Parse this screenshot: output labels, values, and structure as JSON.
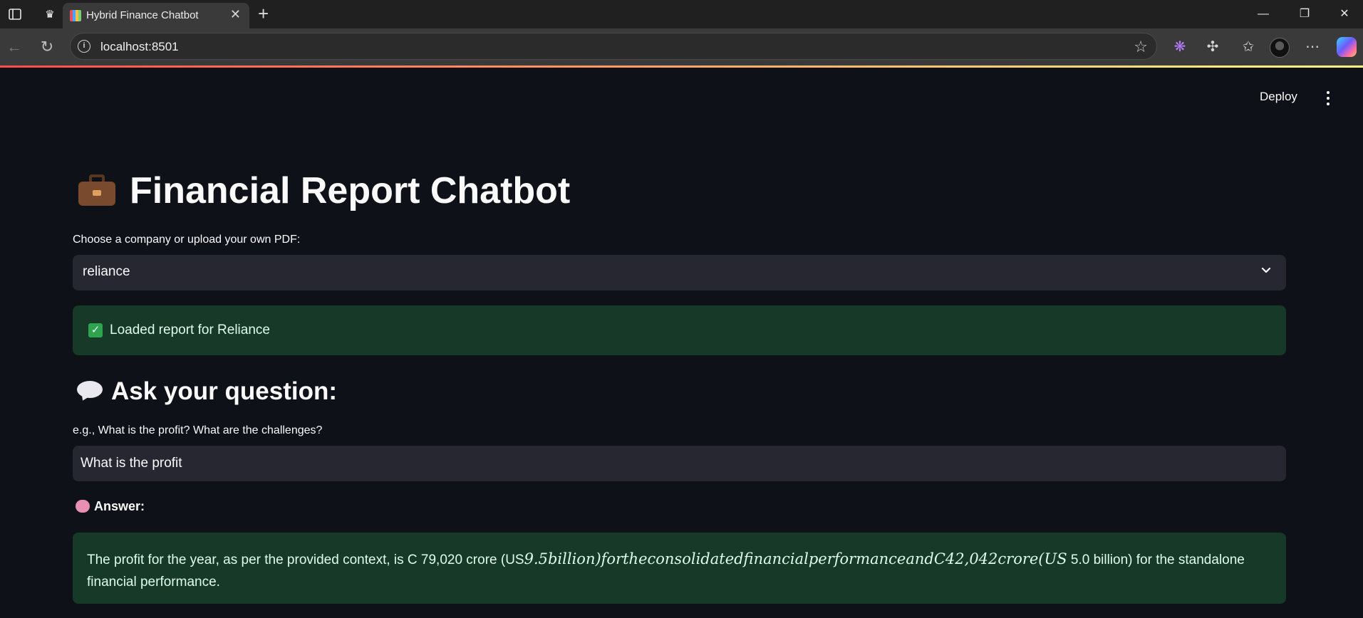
{
  "browser": {
    "tab_title": "Hybrid Finance Chatbot",
    "url": "localhost:8501"
  },
  "header": {
    "deploy_label": "Deploy"
  },
  "page": {
    "title": "Financial Report Chatbot",
    "select_label": "Choose a company or upload your own PDF:",
    "selected_company": "reliance",
    "success_message": "Loaded report for Reliance",
    "ask_heading": "Ask your question:",
    "question_label": "e.g., What is the profit? What are the challenges?",
    "question_value": "What is the profit",
    "answer_label": "Answer:",
    "answer_part1": "The profit for the year, as per the provided context, is C 79,020 crore (US",
    "answer_math": "9.5billion)fortheconsolidatedfinancialperformanceandC42,042crore(US",
    "answer_part2": " 5.0 billion) for the standalone financial performance."
  },
  "colors": {
    "background": "#0e1117",
    "widget_bg": "#262730",
    "success_bg": "#173928",
    "success_text": "#dffde9"
  },
  "icons": [
    "briefcase-icon",
    "speech-bubble-icon",
    "brain-icon",
    "check-icon",
    "chevron-down-icon",
    "kebab-menu-icon"
  ]
}
